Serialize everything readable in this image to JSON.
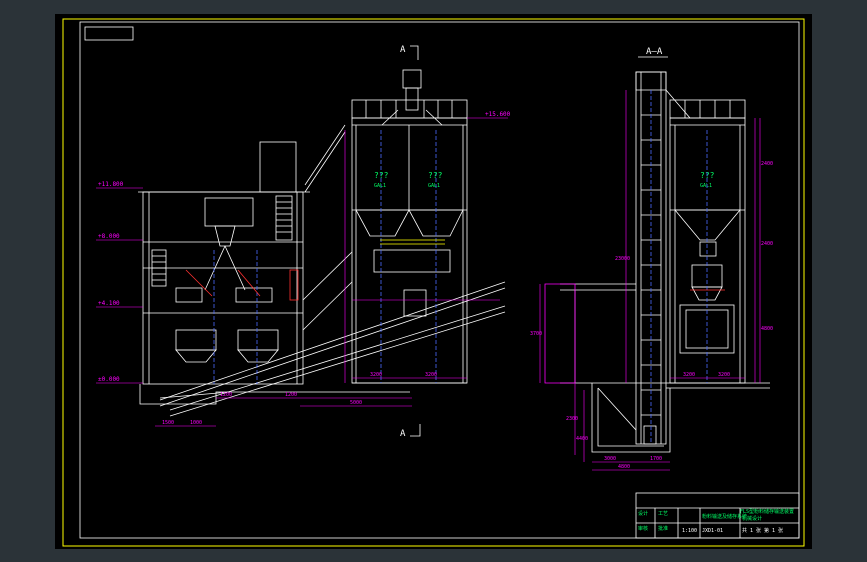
{
  "colors": {
    "window_bg": "#2b3338",
    "sheet": "#000000",
    "border": "#ffff00",
    "structure": "#ffffff",
    "dimension": "#ff00ff",
    "centerline": "#4a6bff",
    "label": "#00ff66",
    "equipment": "#ffffff",
    "accent_red": "#ff3030"
  },
  "views": {
    "left_section_top": "A",
    "left_section_bottom": "A",
    "right_section": "A—A"
  },
  "elevations": [
    "+11.800",
    "+8.000",
    "+4.100",
    "±0.000",
    "+15.600"
  ],
  "silo_labels": {
    "left_bin_1": "???",
    "left_bin_1_sub": "GAL1",
    "left_bin_2": "???",
    "left_bin_2_sub": "GAL1",
    "right_bin": "???",
    "right_bin_sub": "GAL1"
  },
  "dimensions": {
    "bottom_1": "1200",
    "bottom_2": "1200",
    "bottom_3": "5000",
    "base_1": "1500",
    "base_2": "1000",
    "silo_w1": "3200",
    "silo_w2": "3200",
    "right_w1": "3200",
    "right_w2": "3200",
    "pit_1": "3000",
    "pit_2": "1700",
    "pit_total": "4800",
    "v_left_1": "3700",
    "v_right_1": "2400",
    "v_right_2": "2400",
    "v_right_3": "4800",
    "v_elev": "23000",
    "v_pit": "2300",
    "v_pit2": "4400"
  },
  "title_block": {
    "title": "FLS型粉料储存输送装置",
    "subtitle": "粉料输送及储存系统",
    "drawing_no": "JXD1-01",
    "scale": "1:100",
    "sheet": "共 1 张 第 1 张",
    "school": "机械设计",
    "r1": "设计",
    "r2": "审核",
    "r3": "工艺",
    "r4": "批准"
  }
}
